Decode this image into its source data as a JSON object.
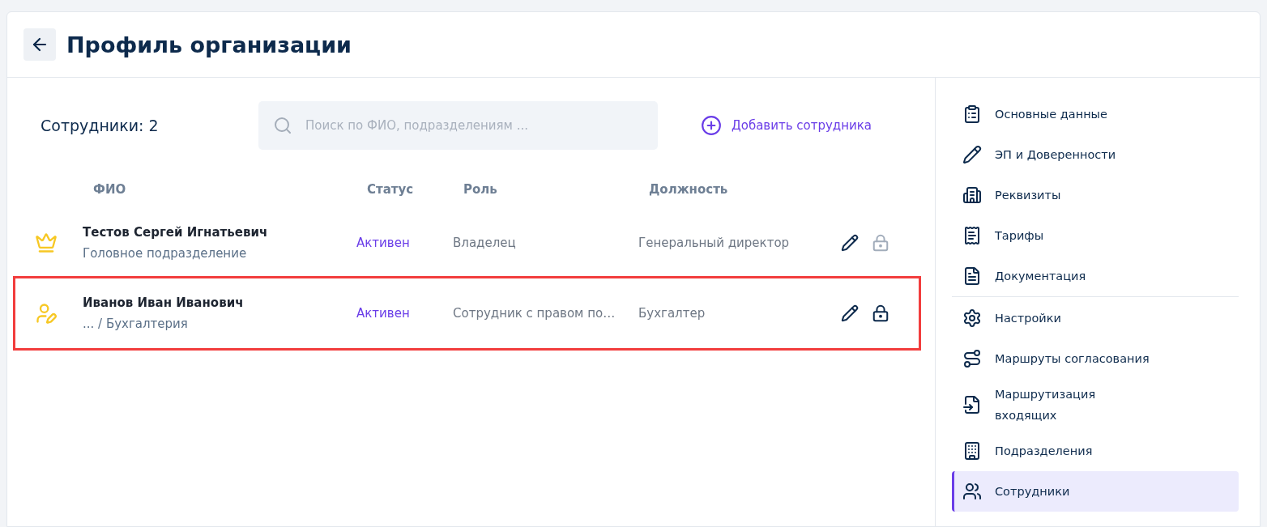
{
  "header": {
    "title": "Профиль организации"
  },
  "toolbar": {
    "count_label": "Сотрудники: 2",
    "search": {
      "placeholder": "Поиск по ФИО, подразделениям ..."
    },
    "add_button": "Добавить сотрудника"
  },
  "table": {
    "columns": [
      "ФИО",
      "Статус",
      "Роль",
      "Должность"
    ],
    "rows": [
      {
        "kind": "owner",
        "name": "Тестов Сергей Игнатьевич",
        "department": "Головное подразделение",
        "status": "Активен",
        "role": "Владелец",
        "position": "Генеральный директор",
        "lock_enabled": false,
        "highlighted": false
      },
      {
        "kind": "signer",
        "name": "Иванов Иван Иванович",
        "department": "... / Бухгалтерия",
        "status": "Активен",
        "role": "Сотрудник с правом по…",
        "position": "Бухгалтер",
        "lock_enabled": true,
        "highlighted": true
      }
    ]
  },
  "sidebar": {
    "sections": [
      {
        "items": [
          {
            "kind": "clipboard",
            "label": "Основные данные",
            "selected": false
          },
          {
            "kind": "pen",
            "label": "ЭП и Доверенности",
            "selected": false
          },
          {
            "kind": "building",
            "label": "Реквизиты",
            "selected": false
          },
          {
            "kind": "receipt",
            "label": "Тарифы",
            "selected": false
          },
          {
            "kind": "document",
            "label": "Документация",
            "selected": false
          }
        ]
      },
      {
        "items": [
          {
            "kind": "gear",
            "label": "Настройки",
            "selected": false
          },
          {
            "kind": "route",
            "label": "Маршруты согласования",
            "selected": false
          },
          {
            "kind": "file-in",
            "label": "Маршрутизация\nвходящих",
            "selected": false
          },
          {
            "kind": "office",
            "label": "Подразделения",
            "selected": false
          },
          {
            "kind": "users",
            "label": "Сотрудники",
            "selected": true
          }
        ]
      }
    ]
  }
}
